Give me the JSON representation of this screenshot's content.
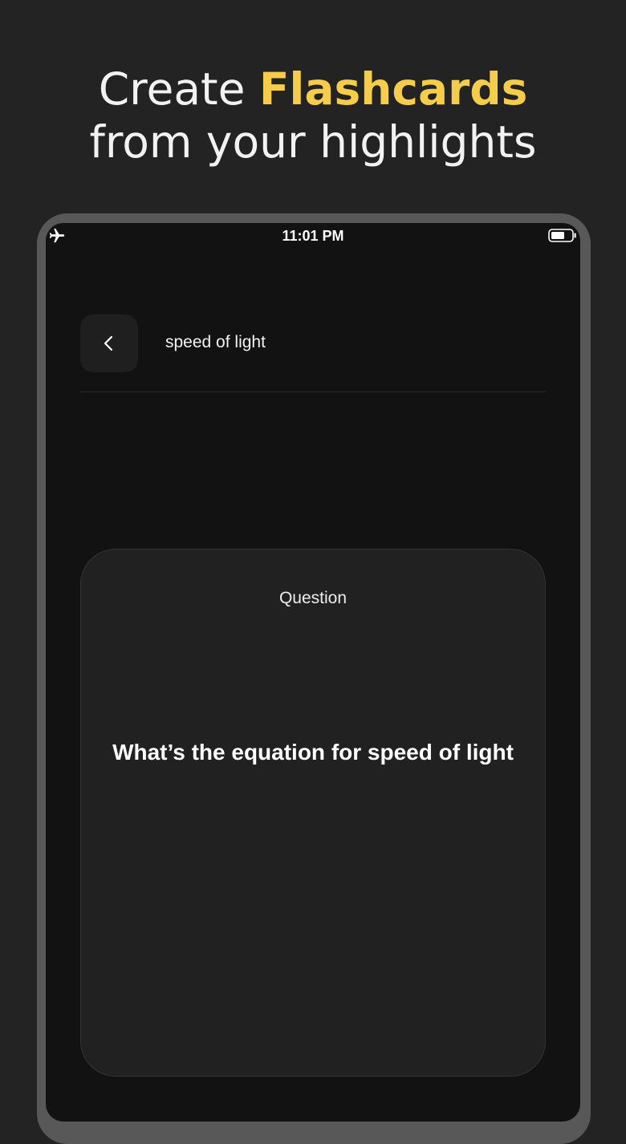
{
  "headline": {
    "prefix": "Create ",
    "accent": "Flashcards",
    "line2": "from your highlights"
  },
  "status_bar": {
    "time": "11:01 PM",
    "left_icon": "airplane-icon",
    "right_icon": "battery-icon"
  },
  "nav": {
    "back_icon": "chevron-left-icon",
    "title": "speed of light"
  },
  "card": {
    "label": "Question",
    "question": "What’s the equation for speed of light"
  },
  "colors": {
    "background": "#232323",
    "accent": "#f6cd4a",
    "device_frame": "#585858",
    "screen": "#121212",
    "card": "#212121"
  }
}
